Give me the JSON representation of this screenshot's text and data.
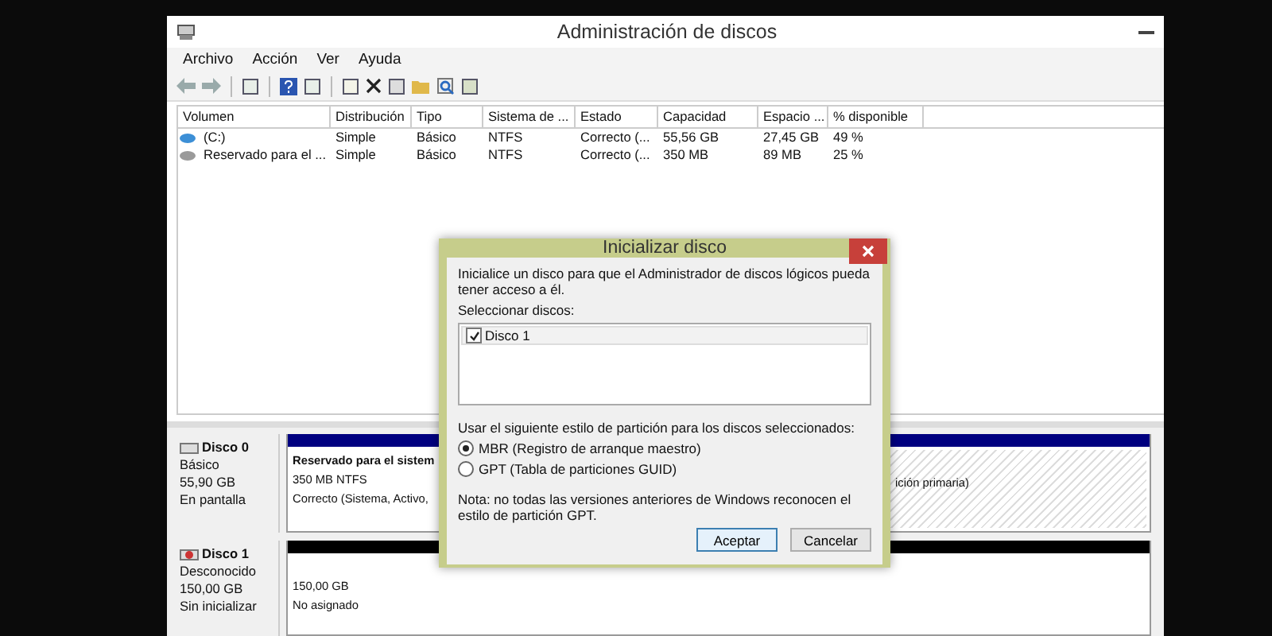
{
  "window": {
    "title": "Administración de discos"
  },
  "menu": [
    "Archivo",
    "Acción",
    "Ver",
    "Ayuda"
  ],
  "table": {
    "columns": [
      "Volumen",
      "Distribución",
      "Tipo",
      "Sistema de ...",
      "Estado",
      "Capacidad",
      "Espacio ...",
      "% disponible"
    ],
    "rows": [
      {
        "color": "#3c8fd6",
        "cells": [
          "(C:)",
          "Simple",
          "Básico",
          "NTFS",
          "Correcto (...",
          "55,56 GB",
          "27,45 GB",
          "49 %"
        ]
      },
      {
        "color": "#9a9a9a",
        "cells": [
          "Reservado para el ...",
          "Simple",
          "Básico",
          "NTFS",
          "Correcto (...",
          "350 MB",
          "89 MB",
          "25 %"
        ]
      }
    ]
  },
  "disks": [
    {
      "name": "Disco 0",
      "kind": "online",
      "lines": [
        "Básico",
        "55,90 GB",
        "En pantalla"
      ],
      "partitions": [
        {
          "kind": "primary",
          "selected": false,
          "title": "Reservado para el sistem",
          "lines": [
            "350 MB NTFS",
            "Correcto (Sistema, Activo,"
          ]
        },
        {
          "kind": "primary",
          "selected": true,
          "lines": [
            "ición primaria)"
          ]
        }
      ]
    },
    {
      "name": "Disco 1",
      "kind": "uninitialized",
      "lines": [
        "Desconocido",
        "150,00 GB",
        "Sin inicializar"
      ],
      "partitions": [
        {
          "kind": "unallocated",
          "selected": false,
          "lines": [
            "150,00 GB",
            "No asignado"
          ]
        }
      ]
    }
  ],
  "dialog": {
    "title": "Inicializar disco",
    "intro": "Inicialice un disco para que el Administrador de discos lógicos pueda tener acceso a él.",
    "list_label": "Seleccionar discos:",
    "disks": [
      {
        "label": "Disco 1",
        "checked": true
      }
    ],
    "style_label": "Usar el siguiente estilo de partición para los discos seleccionados:",
    "options": [
      {
        "label": "MBR (Registro de arranque maestro)",
        "selected": true
      },
      {
        "label": "GPT (Tabla de particiones GUID)",
        "selected": false
      }
    ],
    "note": "Nota: no todas las versiones anteriores de Windows reconocen el estilo de partición GPT.",
    "buttons": [
      {
        "label": "Aceptar",
        "default": true
      },
      {
        "label": "Cancelar",
        "default": false
      }
    ]
  }
}
